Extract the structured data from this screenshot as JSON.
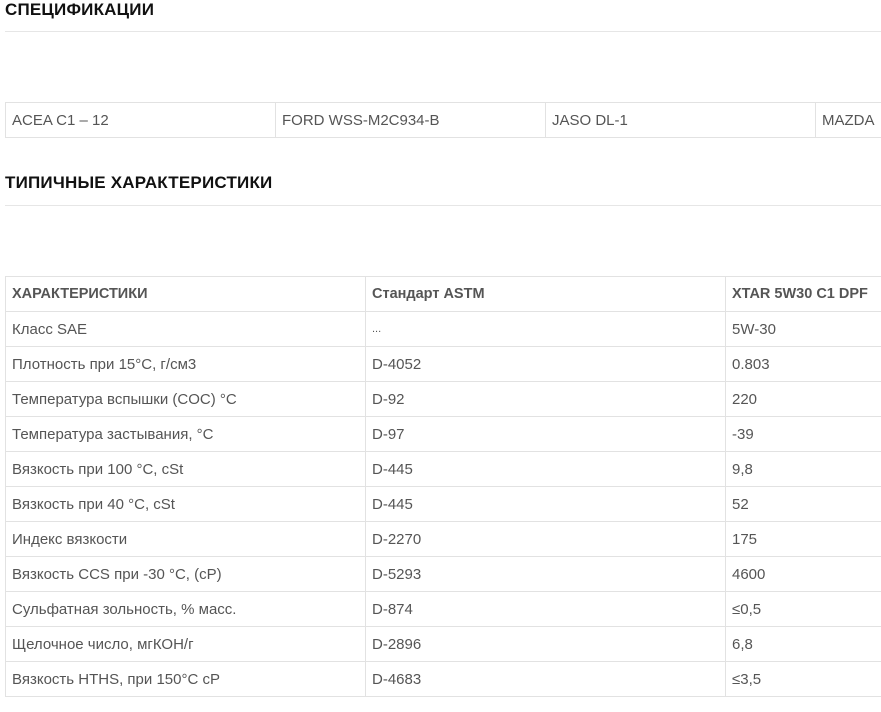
{
  "specifications": {
    "title": "СПЕЦИФИКАЦИИ",
    "items": [
      "ACEA C1 – 12",
      "FORD WSS-M2C934-B",
      "JASO DL-1",
      "MAZDA"
    ]
  },
  "characteristics": {
    "title": "ТИПИЧНЫЕ ХАРАКТЕРИСТИКИ",
    "headers": [
      "ХАРАКТЕРИСТИКИ",
      "Стандарт ASTM",
      "XTAR 5W30 C1 DPF"
    ],
    "rows": [
      [
        "Класс SAE",
        "...",
        "5W-30"
      ],
      [
        "Плотность при 15°C, г/см3",
        "D-4052",
        "0.803"
      ],
      [
        "Температура вспышки (COC) °C",
        "D-92",
        "220"
      ],
      [
        "Температура застывания, °C",
        "D-97",
        "-39"
      ],
      [
        "Вязкость при 100 °C, cSt",
        "D-445",
        "9,8"
      ],
      [
        "Вязкость при 40 °C, cSt",
        "D-445",
        "52"
      ],
      [
        "Индекс вязкости",
        "D-2270",
        "175"
      ],
      [
        "Вязкость CCS при -30 °C, (cP)",
        "D-5293",
        "4600"
      ],
      [
        "Сульфатная зольность, % масс.",
        "D-874",
        "≤0,5"
      ],
      [
        "Щелочное число, мгКОН/г",
        "D-2896",
        "6,8"
      ],
      [
        "Вязкость HTHS, при 150°C cP",
        "D-4683",
        "≤3,5"
      ]
    ]
  }
}
